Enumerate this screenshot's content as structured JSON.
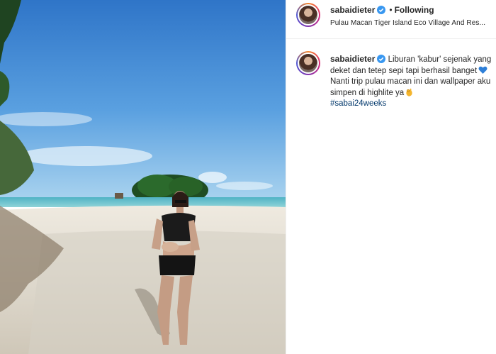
{
  "post": {
    "username": "sabaidieter",
    "separator": "•",
    "follow_status": "Following",
    "location": "Pulau Macan Tiger Island Eco Village And Res..."
  },
  "caption": {
    "username": "sabaidieter",
    "line1": "Liburan 'kabur' sejenak yang deket dan tetep sepi tapi berhasil banget",
    "line2": "Nanti trip pulau macan ini dan wallpaper aku simpen di highlite ya",
    "hashtag": "#sabai24weeks"
  },
  "icons": {
    "verified": "verified-badge-icon",
    "heart": "blue-heart-emoji",
    "hand": "ok-hand-emoji"
  },
  "colors": {
    "verified_blue": "#3897f0",
    "hashtag_blue": "#00376b",
    "heart_blue": "#2e7fd8"
  }
}
